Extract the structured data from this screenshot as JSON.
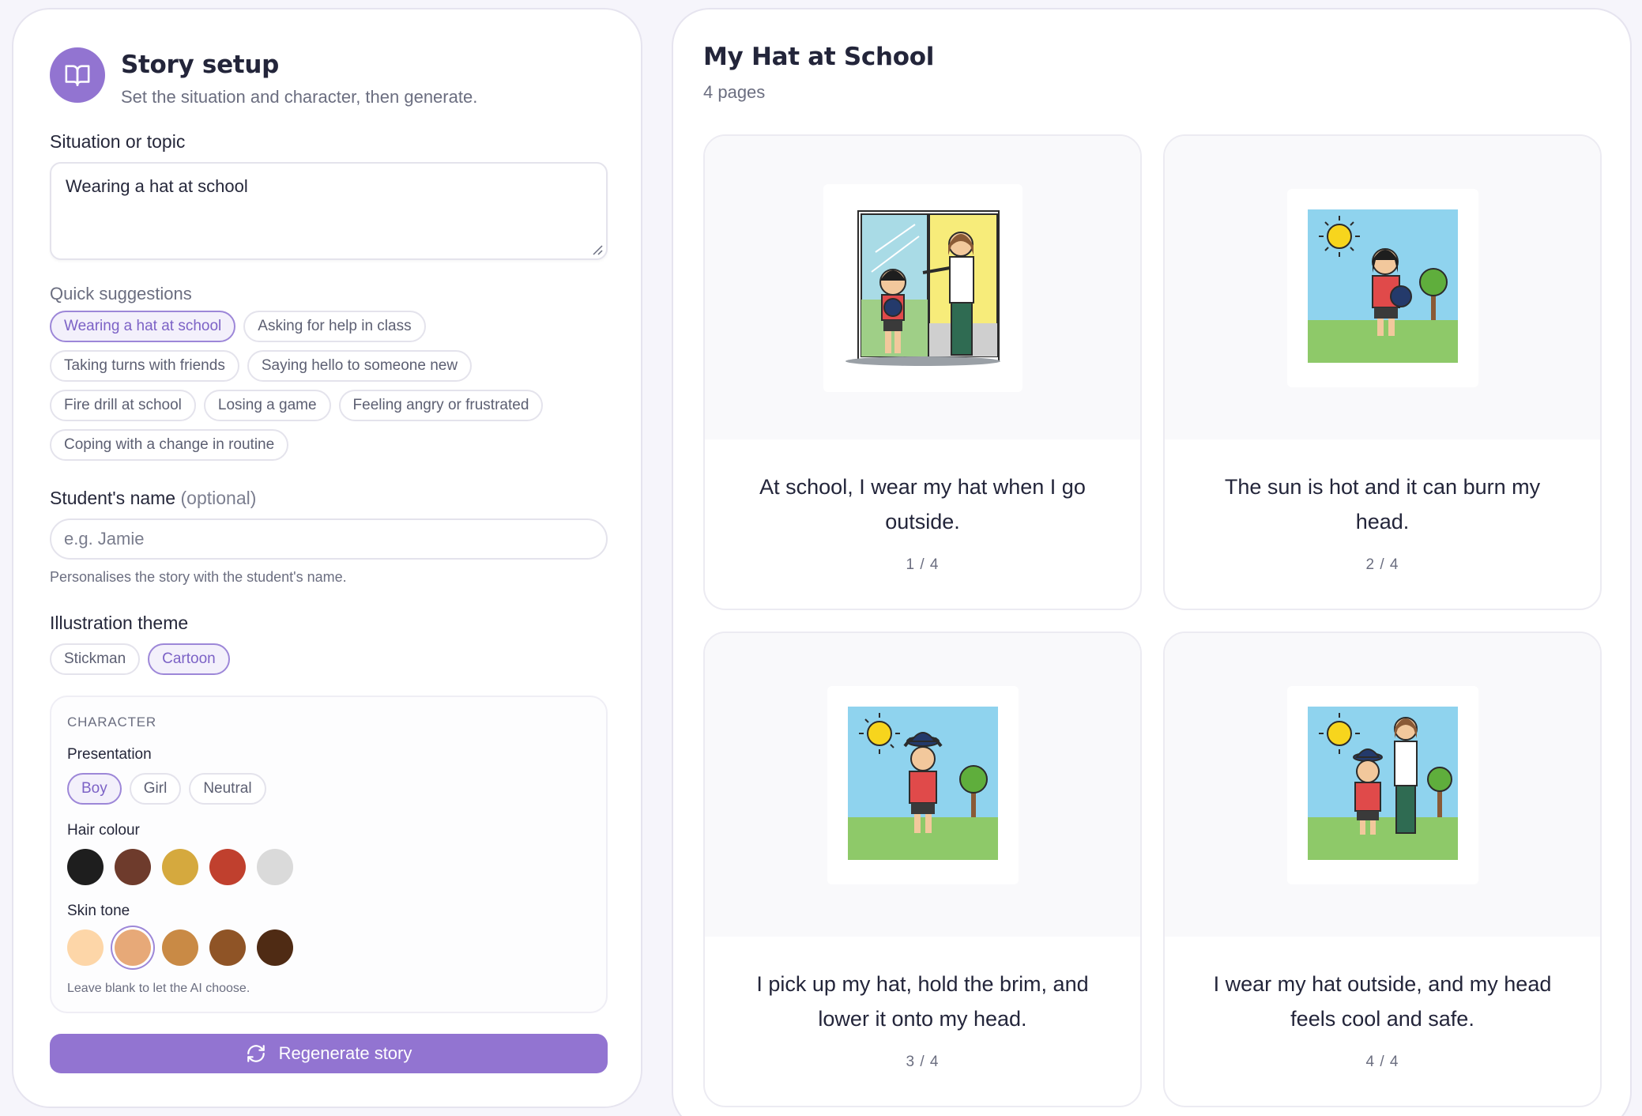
{
  "setup": {
    "title": "Story setup",
    "subtitle": "Set the situation and character, then generate.",
    "topic_label": "Situation or topic",
    "topic_value": "Wearing a hat at school",
    "suggestions_label": "Quick suggestions",
    "suggestions": [
      {
        "label": "Wearing a hat at school",
        "selected": true
      },
      {
        "label": "Asking for help in class",
        "selected": false
      },
      {
        "label": "Taking turns with friends",
        "selected": false
      },
      {
        "label": "Saying hello to someone new",
        "selected": false
      },
      {
        "label": "Fire drill at school",
        "selected": false
      },
      {
        "label": "Losing a game",
        "selected": false
      },
      {
        "label": "Feeling angry or frustrated",
        "selected": false
      },
      {
        "label": "Coping with a change in routine",
        "selected": false
      }
    ],
    "name_label": "Student's name",
    "name_optional": "(optional)",
    "name_placeholder": "e.g. Jamie",
    "name_value": "",
    "name_help": "Personalises the story with the student's name.",
    "theme_label": "Illustration theme",
    "themes": [
      {
        "label": "Stickman",
        "selected": false
      },
      {
        "label": "Cartoon",
        "selected": true
      }
    ],
    "character": {
      "heading": "CHARACTER",
      "presentation_label": "Presentation",
      "presentations": [
        {
          "label": "Boy",
          "selected": true
        },
        {
          "label": "Girl",
          "selected": false
        },
        {
          "label": "Neutral",
          "selected": false
        }
      ],
      "hair_label": "Hair colour",
      "hair_colours": [
        "#1e1e1e",
        "#6e3b2c",
        "#d5a93e",
        "#c0402e",
        "#dadada"
      ],
      "hair_selected": -1,
      "skin_label": "Skin tone",
      "skin_tones": [
        "#fdd6a8",
        "#e7a978",
        "#c98a45",
        "#8f5426",
        "#4f2b14"
      ],
      "skin_selected": 1,
      "help": "Leave blank to let the AI choose."
    },
    "regenerate_label": "Regenerate story"
  },
  "story": {
    "title": "My Hat at School",
    "page_count": "4 pages",
    "pages": [
      {
        "text": "At school, I wear my hat when I go outside.",
        "number": "1 / 4"
      },
      {
        "text": "The sun is hot and it can burn my head.",
        "number": "2 / 4"
      },
      {
        "text": "I pick up my hat, hold the brim, and lower it onto my head.",
        "number": "3 / 4"
      },
      {
        "text": "I wear my hat outside, and my head feels cool and safe.",
        "number": "4 / 4"
      }
    ]
  },
  "colors": {
    "accent": "#9274d1",
    "accent_border": "#9d87d8",
    "accent_bg": "#f3f0fb"
  }
}
